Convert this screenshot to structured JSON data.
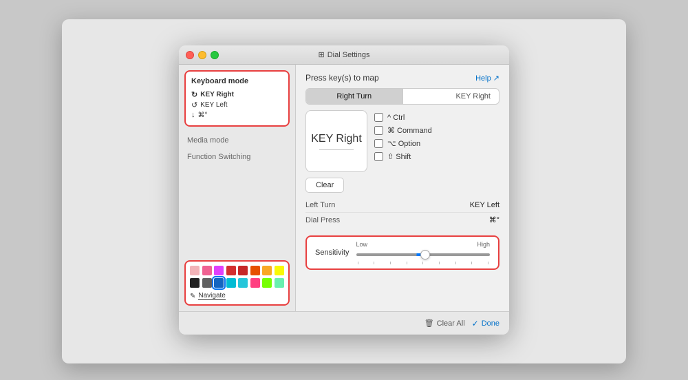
{
  "window": {
    "title": "Dial Settings",
    "title_icon": "⊞"
  },
  "left_panel": {
    "keyboard_mode_label": "Keyboard mode",
    "items": [
      {
        "icon": "↻",
        "label": "KEY Right",
        "active": true
      },
      {
        "icon": "↺",
        "label": "KEY Left",
        "active": false
      },
      {
        "icon": "↓",
        "label": "⌘°",
        "active": false
      }
    ],
    "media_mode_label": "Media mode",
    "function_switching_label": "Function Switching",
    "navigate_label": "Navigate",
    "colors_row1": [
      {
        "color": "#f2b3b8",
        "selected": false
      },
      {
        "color": "#f06292",
        "selected": false
      },
      {
        "color": "#e040fb",
        "selected": false
      },
      {
        "color": "#d32f2f",
        "selected": false
      },
      {
        "color": "#c62828",
        "selected": false
      },
      {
        "color": "#e65100",
        "selected": false
      },
      {
        "color": "#f9a825",
        "selected": false
      },
      {
        "color": "#f9a825",
        "selected": false
      }
    ],
    "colors_row2": [
      {
        "color": "#212121",
        "selected": false
      },
      {
        "color": "#616161",
        "selected": false
      },
      {
        "color": "#1565c0",
        "selected": true
      },
      {
        "color": "#00b8d4",
        "selected": false
      },
      {
        "color": "#00bcd4",
        "selected": false
      },
      {
        "color": "#ff4081",
        "selected": false
      },
      {
        "color": "#76ff03",
        "selected": false
      },
      {
        "color": "#69f0ae",
        "selected": false
      }
    ]
  },
  "right_panel": {
    "press_keys_label": "Press key(s) to map",
    "help_label": "Help ↗",
    "tabs": [
      {
        "label": "Right Turn",
        "active": true
      },
      {
        "label": "KEY Right",
        "active": false
      }
    ],
    "key_display": "KEY Right",
    "modifiers": [
      {
        "label": "^ Ctrl",
        "checked": false
      },
      {
        "label": "⌘ Command",
        "checked": false
      },
      {
        "label": "⌥ Option",
        "checked": false
      },
      {
        "label": "⇧ Shift",
        "checked": false
      }
    ],
    "clear_btn_label": "Clear",
    "bindings": [
      {
        "name": "Left Turn",
        "key": "KEY Left"
      },
      {
        "name": "Dial Press",
        "key": "⌘°"
      }
    ],
    "sensitivity_label": "Sensitivity",
    "sensitivity_low": "Low",
    "sensitivity_high": "High",
    "clear_all_label": "Clear All",
    "done_label": "Done"
  }
}
